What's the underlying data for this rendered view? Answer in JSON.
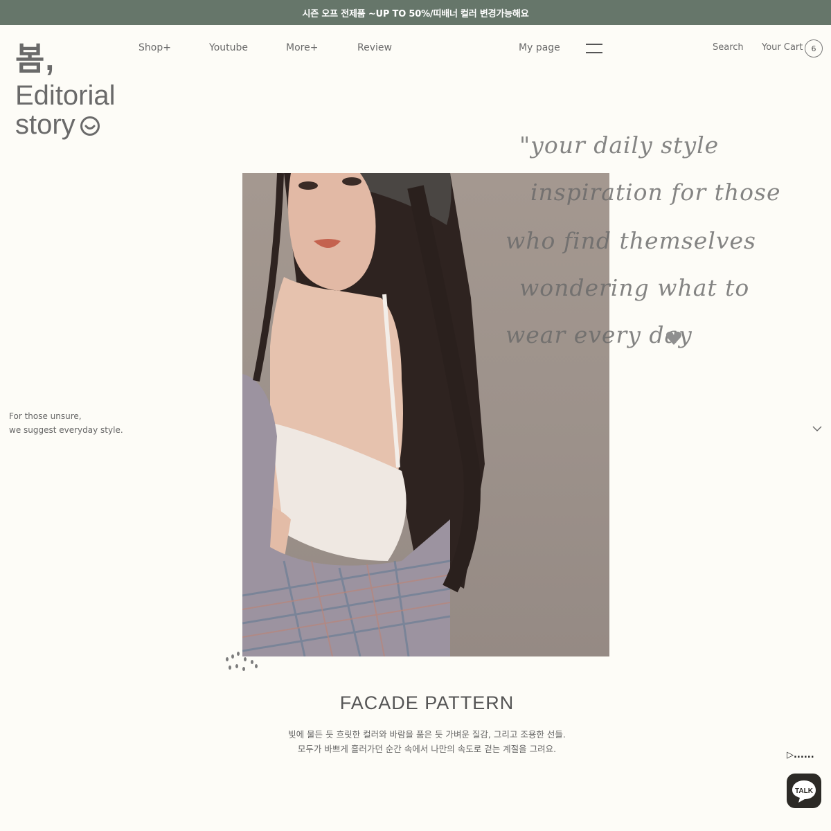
{
  "announcement": "시즌 오프 전제품 ~UP TO 50%/띠배너 컬러 변경가능해요",
  "logo": {
    "line1": "봄,",
    "line2": "Editorial",
    "line3": "story",
    "icon": "smiley-icon"
  },
  "nav": {
    "items": [
      "Shop+",
      "Youtube",
      "More+",
      "Review"
    ],
    "mypage": "My page",
    "search": "Search",
    "cart_label": "Your Cart",
    "cart_count": "6"
  },
  "side_copy": {
    "line1": "For those unsure,",
    "line2": "we suggest everyday style."
  },
  "handwriting": {
    "line1": "\"your daily style",
    "line2": "inspiration for those",
    "line3": "who find themselves",
    "line4": "wondering what to",
    "line5": "wear every day"
  },
  "section": {
    "title": "FACADE PATTERN",
    "desc1": "빛에 물든 듯 흐릿한 컬러와 바람을 품은 듯 가벼운 질감, 그리고 조용한 선들.",
    "desc2": "모두가 바쁘게 흘러가던 순간 속에서 나만의 속도로 걷는 계절을 그려요."
  },
  "widgets": {
    "play_dots": "▷......",
    "talk_label": "TALK"
  },
  "colors": {
    "banner": "#66766a",
    "background": "#fdfcf7",
    "text": "#555555"
  }
}
